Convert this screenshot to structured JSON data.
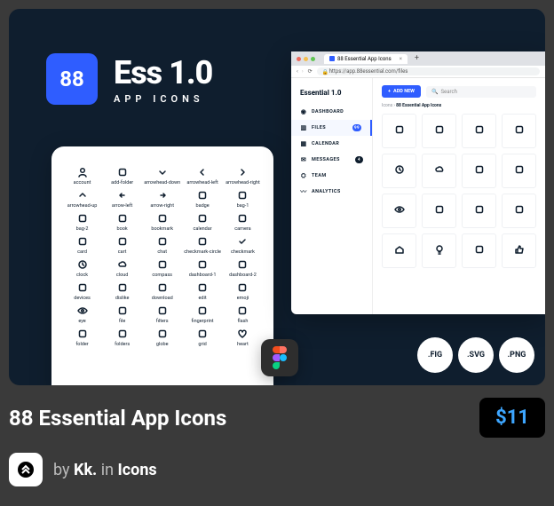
{
  "hero": {
    "badge": "88",
    "title": "Ess 1.0",
    "subtitle": "APP ICONS"
  },
  "sheet_icons": [
    "account",
    "add-folder",
    "arrowhead-down",
    "arrowhead-left",
    "arrowhead-right",
    "arrowhead-up",
    "arrow-left",
    "arrow-right",
    "badge",
    "bag-1",
    "bag-2",
    "book",
    "bookmark",
    "calendar",
    "camera",
    "card",
    "cart",
    "chat",
    "checkmark-circle",
    "checkmark",
    "clock",
    "cloud",
    "compass",
    "dashboard-1",
    "dashboard-2",
    "devices",
    "dislike",
    "download",
    "edit",
    "emoji",
    "eye",
    "file",
    "filters",
    "fingerprint",
    "flash",
    "folder",
    "folders",
    "globe",
    "grid",
    "heart"
  ],
  "browser": {
    "tab_title": "88 Essential App Icons",
    "url": "https://app.88essential.com/files",
    "app_title": "Essential 1.0",
    "add_btn": "ADD NEW",
    "search_placeholder": "Search",
    "crumbs_root": "Icons",
    "crumbs_current": "88 Essential App Icons",
    "nav": [
      {
        "icon": "dashboard",
        "label": "DASHBOARD"
      },
      {
        "icon": "files",
        "label": "FILES",
        "pill": "99",
        "pill_class": "blue",
        "active": true
      },
      {
        "icon": "calendar",
        "label": "CALENDAR"
      },
      {
        "icon": "messages",
        "label": "MESSAGES",
        "pill": "4",
        "pill_class": "dark"
      },
      {
        "icon": "team",
        "label": "TEAM"
      },
      {
        "icon": "analytics",
        "label": "ANALYTICS"
      }
    ],
    "tiles": [
      "bag",
      "book-open",
      "bookmark",
      "calendar",
      "clock",
      "cloud",
      "disc",
      "emoji",
      "eye",
      "file",
      "sliders",
      "accessibility",
      "home",
      "bulb",
      "id",
      "thumbs-up"
    ]
  },
  "formats": [
    ".FIG",
    ".SVG",
    ".PNG"
  ],
  "footer": {
    "title": "88 Essential App Icons",
    "price": "$11",
    "by_prefix": "by ",
    "author": "Kk.",
    "in_word": " in ",
    "category": "Icons"
  }
}
